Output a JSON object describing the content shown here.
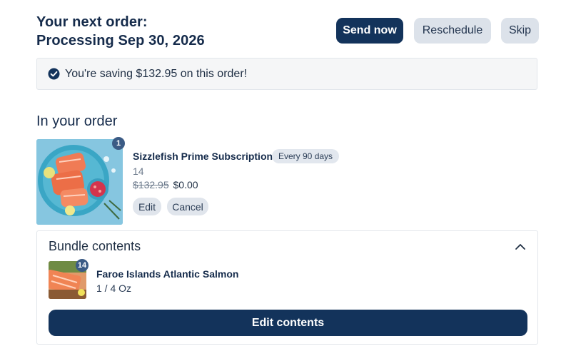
{
  "header": {
    "title_line1": "Your next order:",
    "title_line2": "Processing Sep 30, 2026"
  },
  "actions": {
    "send_now": "Send now",
    "reschedule": "Reschedule",
    "skip": "Skip"
  },
  "savings": {
    "icon": "check-circle-icon",
    "text": "You're saving $132.95 on this order!"
  },
  "order": {
    "section_title": "In your order",
    "item": {
      "quantity": "1",
      "name": "Sizzlefish Prime Subscription",
      "frequency": "Every 90 days",
      "meta": "14",
      "price_original": "$132.95",
      "price_current": "$0.00",
      "edit_label": "Edit",
      "cancel_label": "Cancel"
    }
  },
  "bundle": {
    "title": "Bundle contents",
    "toggle_icon": "chevron-up-icon",
    "item": {
      "quantity": "14",
      "name": "Faroe Islands Atlantic Salmon",
      "size": "1 / 4 Oz"
    },
    "edit_contents_label": "Edit contents"
  },
  "colors": {
    "primary": "#13335b",
    "secondary_button": "#dce2ea",
    "badge": "#3b5b85"
  }
}
